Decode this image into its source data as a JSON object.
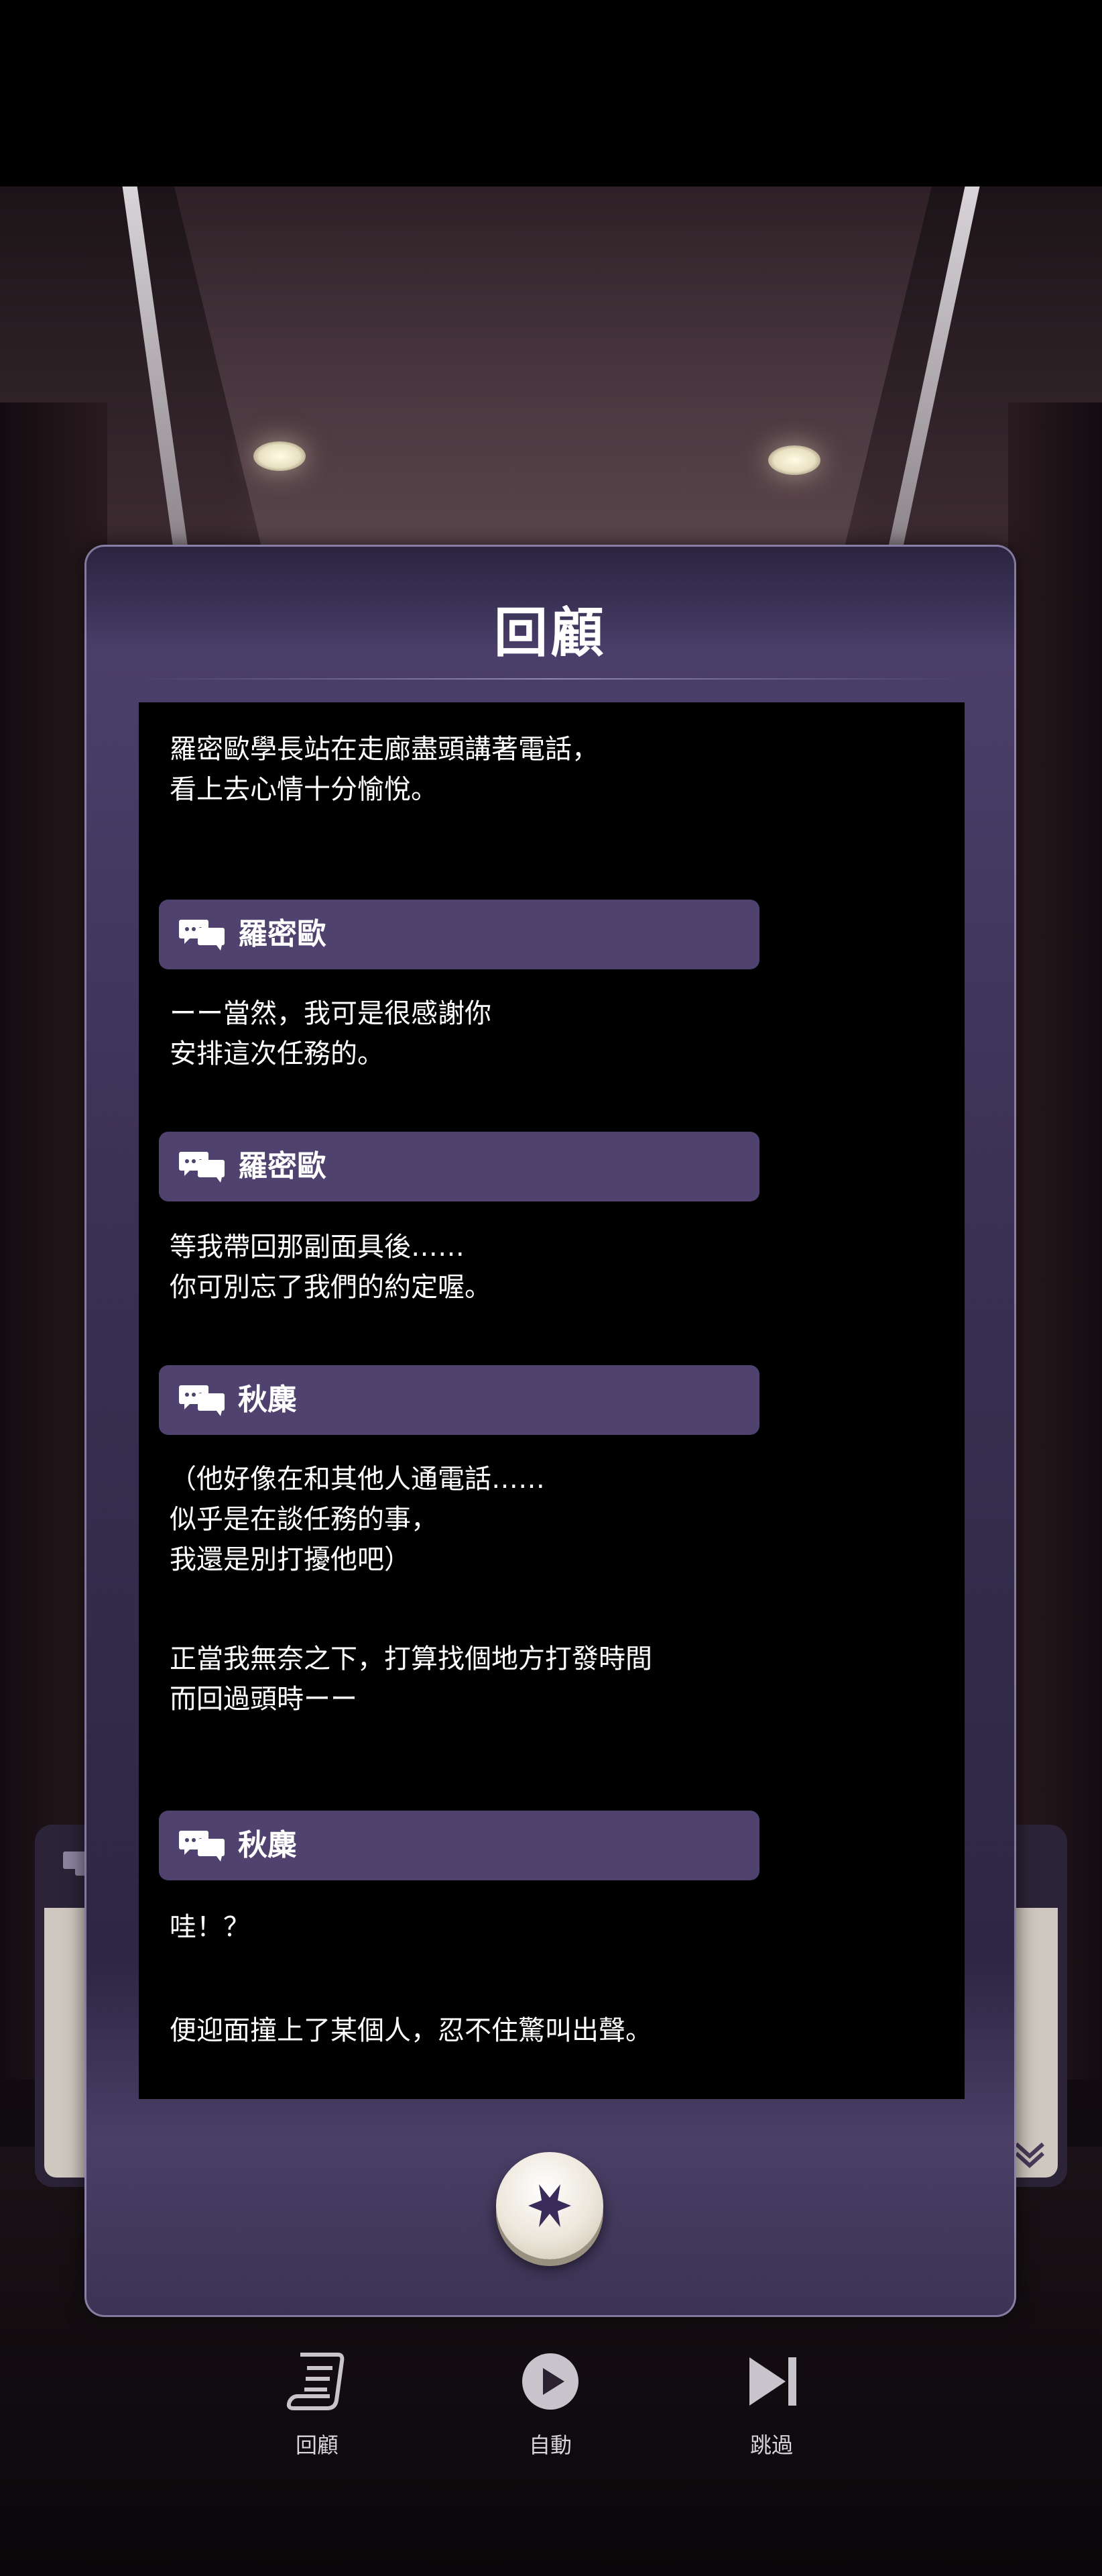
{
  "panel": {
    "title": "回顧",
    "close_icon": "close-x-icon"
  },
  "log": [
    {
      "type": "narration",
      "text": "羅密歐學長站在走廊盡頭講著電話，\n看上去心情十分愉悅。"
    },
    {
      "type": "speaker",
      "name": "羅密歐",
      "icon": "chat-bubbles-icon"
    },
    {
      "type": "dialogue",
      "text": "ーー當然，我可是很感謝你\n安排這次任務的。"
    },
    {
      "type": "speaker",
      "name": "羅密歐",
      "icon": "chat-bubbles-icon"
    },
    {
      "type": "dialogue",
      "text": "等我帶回那副面具後……\n你可別忘了我們的約定喔。"
    },
    {
      "type": "speaker",
      "name": "秋麋",
      "icon": "chat-bubbles-icon"
    },
    {
      "type": "dialogue",
      "text": "（他好像在和其他人通電話……\n似乎是在談任務的事，\n我還是別打擾他吧）"
    },
    {
      "type": "narration",
      "text": "正當我無奈之下，打算找個地方打發時間\n而回過頭時ーー"
    },
    {
      "type": "speaker",
      "name": "秋麋",
      "icon": "chat-bubbles-icon"
    },
    {
      "type": "dialogue",
      "text": "哇！？"
    },
    {
      "type": "narration",
      "text": "便迎面撞上了某個人，忍不住驚叫出聲。"
    }
  ],
  "controls": {
    "review_label": "回顧",
    "auto_label": "自動",
    "skip_label": "跳過"
  },
  "colors": {
    "panel": "#3a3052",
    "speaker_bar": "#4f426e",
    "log_bg": "#000000",
    "text": "#ffffff"
  }
}
